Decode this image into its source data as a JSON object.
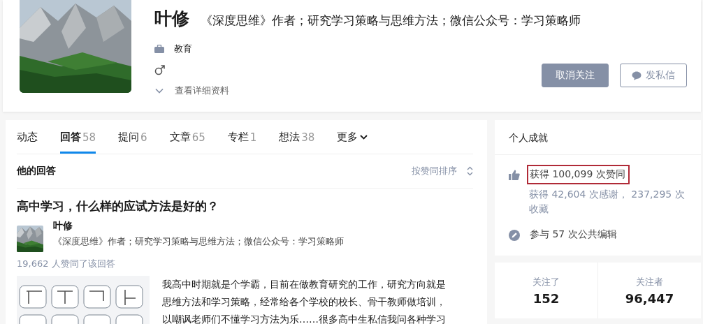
{
  "profile": {
    "name": "叶修",
    "headline": "《深度思维》作者；研究学习策略与思维方法；微信公众号：学习策略师",
    "industry": "教育",
    "more_link": "查看详细资料",
    "buttons": [
      {
        "label": "取消关注",
        "kind": "primary"
      },
      {
        "label": "发私信",
        "kind": "message"
      }
    ]
  },
  "tabs": [
    {
      "label": "动态",
      "selected": false
    },
    {
      "label": "回答",
      "count": "58",
      "selected": true
    },
    {
      "label": "提问",
      "count": "6",
      "selected": false
    },
    {
      "label": "文章",
      "count": "65",
      "selected": false
    },
    {
      "label": "专栏",
      "count": "1",
      "selected": false
    },
    {
      "label": "想法",
      "count": "38",
      "selected": false
    },
    {
      "label": "更多",
      "selected": false,
      "dropdown": true
    }
  ],
  "answers": {
    "title": "他的回答",
    "sort": "按赞同排序",
    "items": [
      {
        "question": "高中学习，什么样的应试方法是好的？",
        "author": "叶修",
        "author_bio": "《深度思维》作者；研究学习策略与思维方法；微信公众号：学习策略师",
        "votes": "19,662 人赞同了该回答",
        "excerpt": [
          "我高中时期就是个学霸，目前在做教育研究的工作，研究方向就是",
          "思维方法和学习策略，经常给各个学校的校长、骨干教师做培训，",
          "以嘲讽老师们不懂学习方法为乐……很多高中生私信我问各种学习"
        ]
      }
    ]
  },
  "achievements": {
    "title": "个人成就",
    "items": [
      {
        "kind": "upvotes",
        "text": "获得 100,099 次赞同",
        "highlighted": true,
        "detail": "获得 42,604 次感谢， 237,295 次收藏"
      },
      {
        "kind": "edits",
        "text": "参与 57 次公共编辑",
        "highlighted": false
      }
    ]
  },
  "follow_stats": [
    {
      "label": "关注了",
      "value": "152"
    },
    {
      "label": "关注者",
      "value": "96,447"
    }
  ]
}
